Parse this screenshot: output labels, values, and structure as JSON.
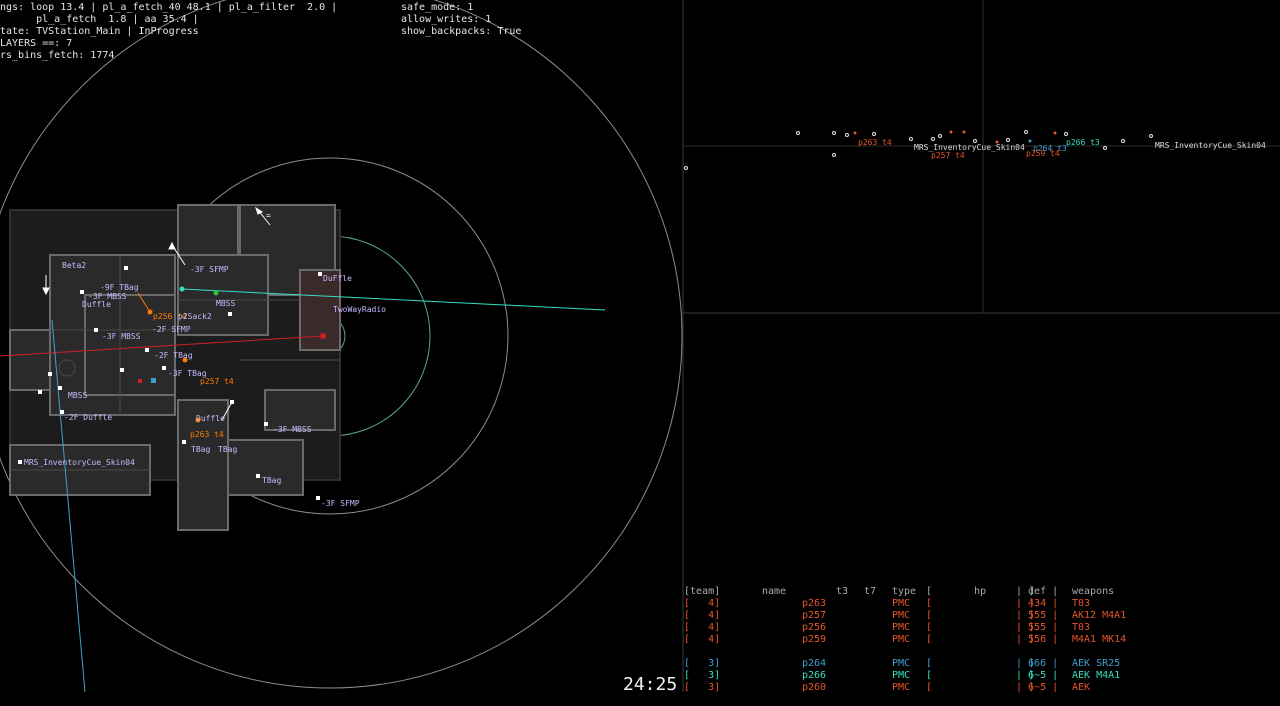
{
  "hud": {
    "line1": "ngs: loop 13.4 | pl_a_fetch_40 48.1 | pl_a_filter  2.0 |",
    "line2": "      pl_a_fetch  1.8 | aa 35.4 |",
    "line3": "tate: TVStation_Main | InProgress",
    "line4": "LAYERS ==: 7",
    "line5": "rs_bins_fetch: 1774",
    "safe_mode": "safe_mode: 1",
    "allow_writes": "allow_writes: 1",
    "show_backpacks": "show_backpacks: True"
  },
  "map_labels": [
    "Beta2",
    "-9F TBag",
    "-3F MBSS",
    "Duffle",
    "-3F SFMP",
    "DuFfle",
    "TwoWayRadio",
    "MBSS",
    "p256 t4",
    "p2Sack2",
    "-2F SFMP",
    "-3F MBSS",
    "-2F TBag",
    "-3F TBag",
    "p257 t4",
    "MBSS",
    "-2F Duffle",
    "MRS_InventoryCue_Skin04",
    "Duffle",
    "p263 t4",
    "-3F MBSS",
    "TBag",
    "TBag",
    "TBag",
    "-3F SFMP",
    "="
  ],
  "side_labels": [
    "p263 t4",
    "MRS_InventoryCue_Skin04",
    "p257 t4",
    "p264 t3",
    "p266 t3",
    "p259 t4",
    "MRS_InventoryCue_Skin04"
  ],
  "timer": "24:25",
  "roster": {
    "header": {
      "team": "[team]",
      "name": "name",
      "t3": "t3",
      "t7": "t7",
      "type": "type",
      "hp": "[       hp       ]",
      "def": "| def |",
      "weapons": "weapons"
    },
    "rows": [
      {
        "team": "[   4]",
        "name": "p263",
        "t3": "",
        "t7": "",
        "type": "PMC",
        "hp": "[                ]",
        "def": "| 434 |",
        "weapons": "T03",
        "color": "#e8542a"
      },
      {
        "team": "[   4]",
        "name": "p257",
        "t3": "",
        "t7": "",
        "type": "PMC",
        "hp": "[                ]",
        "def": "| 555 |",
        "weapons": "AK12 M4A1",
        "color": "#e8542a"
      },
      {
        "team": "[   4]",
        "name": "p256",
        "t3": "",
        "t7": "",
        "type": "PMC",
        "hp": "[                ]",
        "def": "| 555 |",
        "weapons": "T03",
        "color": "#e8542a"
      },
      {
        "team": "[   4]",
        "name": "p259",
        "t3": "",
        "t7": "",
        "type": "PMC",
        "hp": "[                ]",
        "def": "| 556 |",
        "weapons": "M4A1 MK14",
        "color": "#e8542a"
      },
      {
        "team": "",
        "name": "",
        "t3": "",
        "t7": "",
        "type": "",
        "hp": "",
        "def": "",
        "weapons": "",
        "color": "#000"
      },
      {
        "team": "[   3]",
        "name": "p264",
        "t3": "",
        "t7": "",
        "type": "PMC",
        "hp": "[                ]",
        "def": "| 666 |",
        "weapons": "AEK SR25",
        "color": "#3f9fd0"
      },
      {
        "team": "[   3]",
        "name": "p266",
        "t3": "",
        "t7": "",
        "type": "PMC",
        "hp": "[                ]",
        "def": "| 6~5 |",
        "weapons": "AEK M4A1",
        "color": "#35e0c0"
      },
      {
        "team": "[   3]",
        "name": "p260",
        "t3": "",
        "t7": "",
        "type": "PMC",
        "hp": "[                ]",
        "def": "| 6~5 |",
        "weapons": "AEK",
        "color": "#e8542a"
      }
    ]
  },
  "colors": {
    "team4": "#e8542a",
    "team3": "#3f9fd0",
    "team3_alt": "#35e0c0",
    "label": "#c9b8ff",
    "ring": "#8c8c8c"
  }
}
